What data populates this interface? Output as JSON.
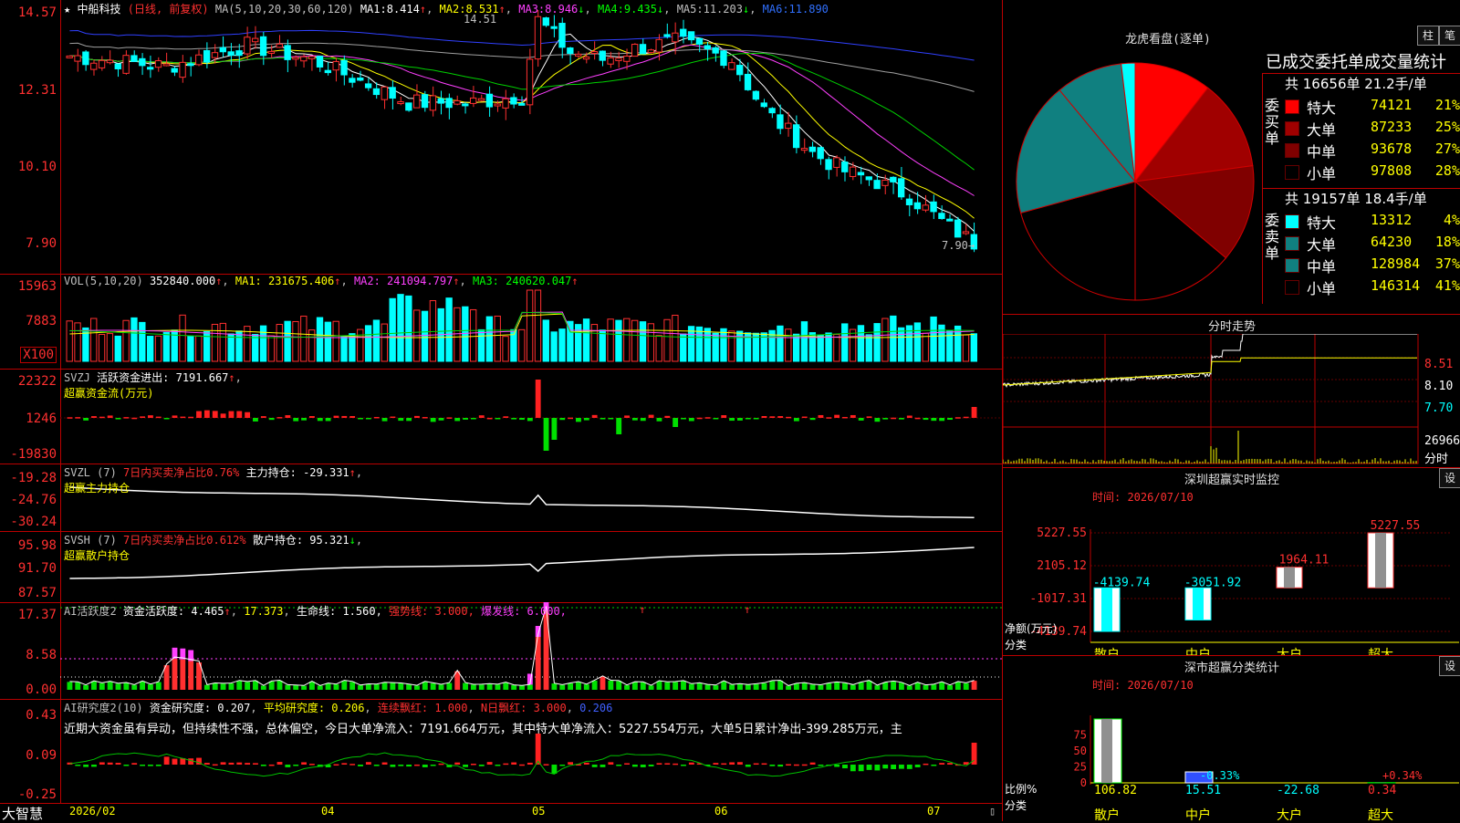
{
  "colors": {
    "up": "#ff3030",
    "down": "#00ffff",
    "vol_up": "#ff3030",
    "vol_dn": "#00ffff",
    "flow_up": "#ff2020",
    "flow_dn": "#00e000",
    "grid": "#b00000",
    "white": "#ffffff",
    "yellow": "#ffff00",
    "magenta": "#ff40ff",
    "green": "#00d000",
    "gray": "#a0a0a0",
    "blue": "#3040ff"
  },
  "main": {
    "stock_name": "中船科技",
    "period": "(日线, 前复权)",
    "ma_params": "MA(5,10,20,30,60,120)",
    "ma": [
      {
        "label": "MA1:",
        "value": "8.414"
      },
      {
        "label": "MA2:",
        "value": "8.531"
      },
      {
        "label": "MA3:",
        "value": "8.946"
      },
      {
        "label": "MA4:",
        "value": "9.435"
      },
      {
        "label": "MA5:",
        "value": "11.203"
      },
      {
        "label": "MA6:",
        "value": "11.890"
      }
    ],
    "yticks": [
      "14.57",
      "12.31",
      "10.10",
      "7.90"
    ],
    "high_note": "14.51",
    "low_note": "7.90"
  },
  "vol": {
    "label": "VOL(5,10,20)",
    "value": "352840.000",
    "ma1": "MA1: 231675.406",
    "ma2": "MA2: 241094.797",
    "ma3": "MA3: 240620.047",
    "yticks": [
      "15963",
      "7883",
      "X100"
    ]
  },
  "svzj": {
    "label": "SVZJ",
    "text1": "活跃资金进出: 7191.667",
    "sub": "超赢资金流(万元)",
    "yticks": [
      "22322",
      "1246",
      "-19830"
    ]
  },
  "svzl": {
    "label": "SVZL (7)",
    "pct": "7日内买卖净占比0.76%",
    "hold": "主力持仓: -29.331",
    "sub": "超赢主力持仓",
    "yticks": [
      "-19.28",
      "-24.76",
      "-30.24"
    ]
  },
  "svsh": {
    "label": "SVSH (7)",
    "pct": "7日内买卖净占比0.612%",
    "hold": "散户持仓: 95.321",
    "sub": "超赢散户持仓",
    "yticks": [
      "95.98",
      "91.70",
      "87.57"
    ]
  },
  "ai2": {
    "label": "AI活跃度2",
    "a": "资金活跃度: 4.465",
    "b": "17.373",
    "c": "生命线: 1.560,",
    "d": "强势线: 3.000,",
    "e": "爆发线: 6.000,",
    "yticks": [
      "17.37",
      "8.58",
      "0.00"
    ]
  },
  "ai3": {
    "label": "AI研究度2(10)",
    "a": "资金研究度: 0.207",
    "b": "平均研究度: 0.206",
    "c": "连续飘红: 1.000",
    "d": "N日飘红: 3.000",
    "e": "0.206",
    "text": "近期大资金虽有异动，但持续性不强，总体偏空，今日大单净流入：7191.664万元，其中特大单净流入：5227.554万元，大单5日累计净出-399.285万元，主",
    "yticks": [
      "0.43",
      "0.09",
      "-0.25"
    ]
  },
  "bottom": {
    "brand": "大智慧",
    "dates": [
      "2026/02",
      "04",
      "05",
      "06",
      "07"
    ]
  },
  "pie": {
    "title": "龙虎看盘(逐单)",
    "btn1": "柱",
    "btn2": "笔",
    "subtitle": "已成交委托单成交量统计",
    "buy": {
      "side": "委买单",
      "summary": "共 16656单 21.2手/单",
      "rows": [
        {
          "name": "特大",
          "vol": "74121",
          "pct": "21%",
          "color": "#ff0000"
        },
        {
          "name": "大单",
          "vol": "87233",
          "pct": "25%",
          "color": "#a00000"
        },
        {
          "name": "中单",
          "vol": "93678",
          "pct": "27%",
          "color": "#800000"
        },
        {
          "name": "小单",
          "vol": "97808",
          "pct": "28%",
          "color": "#000000"
        }
      ]
    },
    "sell": {
      "side": "委卖单",
      "summary": "共 19157单 18.4手/单",
      "rows": [
        {
          "name": "特大",
          "vol": "13312",
          "pct": "4%",
          "color": "#00ffff"
        },
        {
          "name": "大单",
          "vol": "64230",
          "pct": "18%",
          "color": "#108080"
        },
        {
          "name": "中单",
          "vol": "128984",
          "pct": "37%",
          "color": "#108080"
        },
        {
          "name": "小单",
          "vol": "146314",
          "pct": "41%",
          "color": "#000000"
        }
      ]
    }
  },
  "intraday": {
    "title": "分时走势",
    "yticks": [
      "8.51",
      "8.10",
      "7.70"
    ],
    "vol_label": "26966",
    "vol_unit": "分时"
  },
  "monitor": {
    "title": "深圳超赢实时监控",
    "btn": "设",
    "time": "时间: 2026/07/10",
    "yticks": [
      "5227.55",
      "2105.12",
      "-1017.31",
      "-4139.74"
    ],
    "ylabel": "净额(万元)",
    "xlabel": "分类",
    "bars": [
      {
        "cat": "散户",
        "value": -4139.74,
        "label": "-4139.74"
      },
      {
        "cat": "中户",
        "value": -3051.92,
        "label": "-3051.92"
      },
      {
        "cat": "大户",
        "value": 1964.11,
        "label": "1964.11"
      },
      {
        "cat": "超大",
        "value": 5227.55,
        "label": "5227.55"
      }
    ]
  },
  "classify": {
    "title": "深市超赢分类统计",
    "btn": "设",
    "time": "时间: 2026/07/10",
    "yticks": [
      "75",
      "50",
      "25",
      "0"
    ],
    "ylabel": "比例%",
    "xlabel": "分类",
    "bars": [
      {
        "cat": "散户",
        "value": 106.82,
        "label": "106.82",
        "pct": ""
      },
      {
        "cat": "中户",
        "value": 15.51,
        "label": "15.51",
        "pct": "-0.33%"
      },
      {
        "cat": "大户",
        "value": -22.68,
        "label": "-22.68",
        "pct": ""
      },
      {
        "cat": "超大",
        "value": 0.34,
        "label": "0.34",
        "pct": "+0.34%"
      }
    ]
  }
}
